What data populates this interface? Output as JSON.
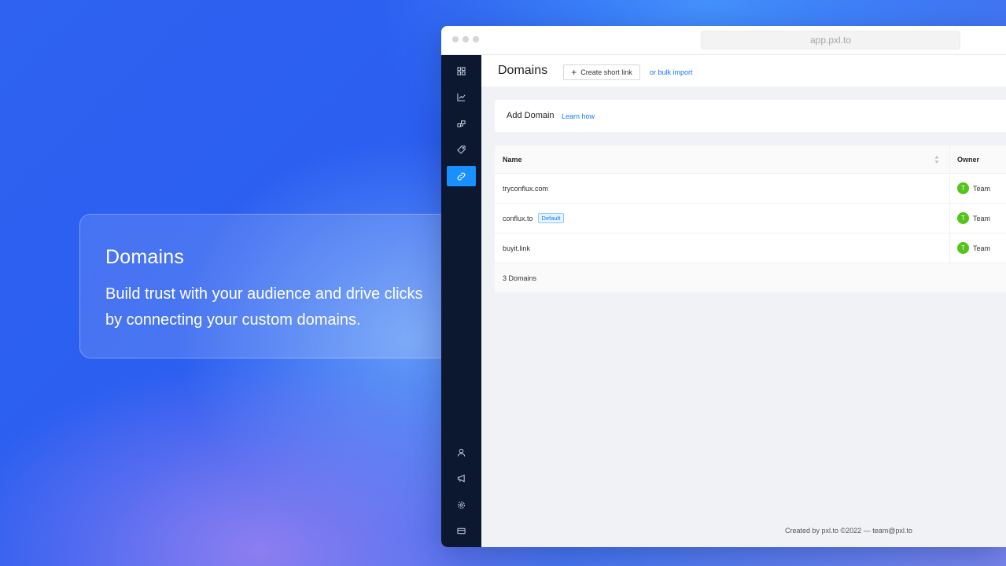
{
  "promo": {
    "title": "Domains",
    "description": "Build trust with your audience and drive clicks by connecting your custom domains."
  },
  "browser": {
    "url": "app.pxl.to"
  },
  "sidebar": {
    "top_items": [
      {
        "icon": "dashboard-icon"
      },
      {
        "icon": "analytics-chart-icon"
      },
      {
        "icon": "groups-icon"
      },
      {
        "icon": "tag-icon"
      },
      {
        "icon": "link-icon",
        "active": true
      }
    ],
    "bottom_items": [
      {
        "icon": "user-icon"
      },
      {
        "icon": "megaphone-icon"
      },
      {
        "icon": "settings-gear-icon"
      },
      {
        "icon": "billing-card-icon"
      }
    ],
    "active_color": "#1890ff"
  },
  "header": {
    "title": "Domains",
    "create_button": "Create short link",
    "bulk_import": "or bulk import"
  },
  "add_domain": {
    "title": "Add Domain",
    "learn_link": "Learn how"
  },
  "table": {
    "columns": [
      "Name",
      "Owner"
    ],
    "rows": [
      {
        "name": "tryconflux.com",
        "badge": "",
        "owner_initial": "T",
        "owner": "Team"
      },
      {
        "name": "conflux.to",
        "badge": "Default",
        "owner_initial": "T",
        "owner": "Team"
      },
      {
        "name": "buyit.link",
        "badge": "",
        "owner_initial": "T",
        "owner": "Team"
      }
    ],
    "footer": "3 Domains"
  },
  "footer": "Created by pxl.to ©2022 — team@pxl.to"
}
